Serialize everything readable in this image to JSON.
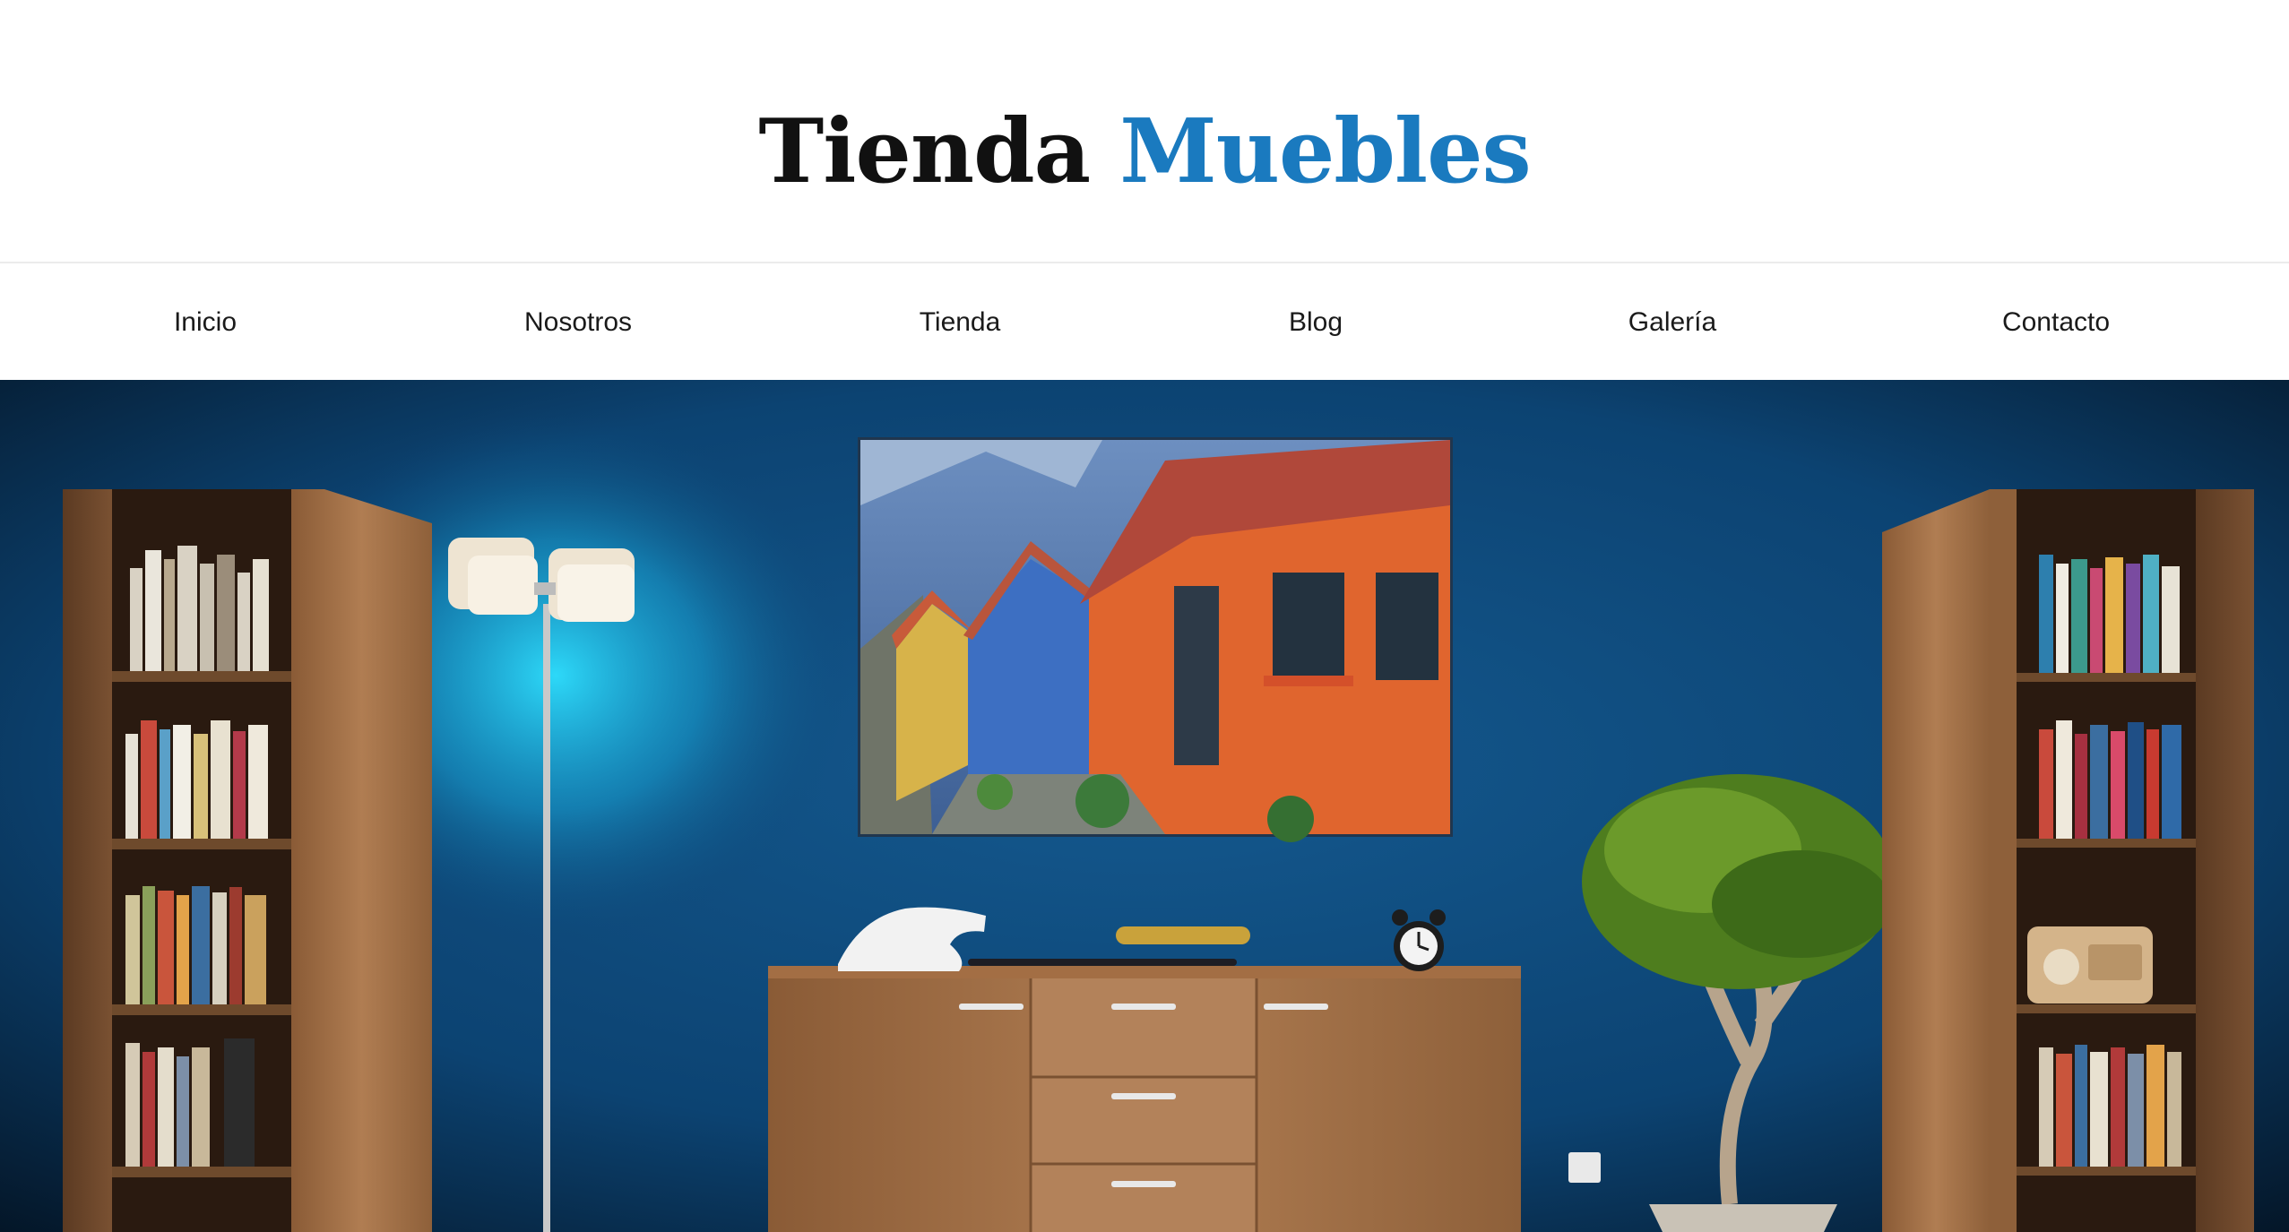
{
  "site": {
    "logo_part1": "Tienda",
    "logo_part2": "Muebles",
    "brand_accent": "#1a7abf"
  },
  "nav": {
    "items": [
      {
        "label": "Inicio"
      },
      {
        "label": "Nosotros"
      },
      {
        "label": "Tienda"
      },
      {
        "label": "Blog"
      },
      {
        "label": "Galería"
      },
      {
        "label": "Contacto"
      }
    ]
  },
  "hero": {
    "wall_color": "#0d4a7d",
    "wood_color": "#a8764c"
  }
}
